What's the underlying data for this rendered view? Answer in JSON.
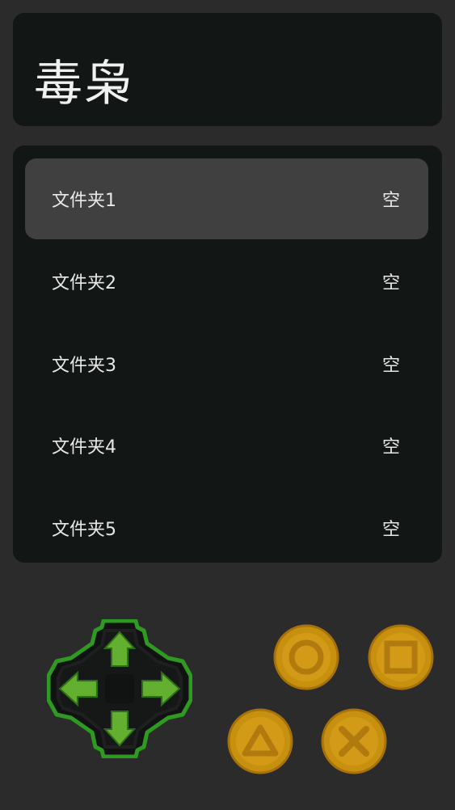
{
  "header": {
    "title": "毒枭"
  },
  "folders": {
    "items": [
      {
        "label": "文件夹1",
        "status": "空",
        "selected": true
      },
      {
        "label": "文件夹2",
        "status": "空",
        "selected": false
      },
      {
        "label": "文件夹3",
        "status": "空",
        "selected": false
      },
      {
        "label": "文件夹4",
        "status": "空",
        "selected": false
      },
      {
        "label": "文件夹5",
        "status": "空",
        "selected": false
      }
    ]
  },
  "controls": {
    "dpad_color": "#3fa32a",
    "button_color": "#c8900f",
    "buttons": [
      "circle",
      "square",
      "triangle",
      "cross"
    ]
  }
}
